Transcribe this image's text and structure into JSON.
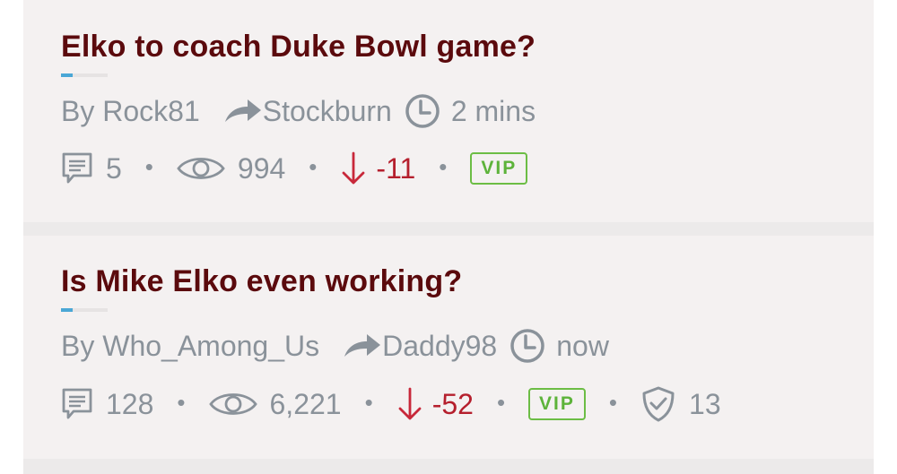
{
  "threads": [
    {
      "title": "Elko to coach Duke Bowl game?",
      "author": "By Rock81",
      "last_reply_by": "Stockburn",
      "time": "2 mins",
      "read_progress": 0.25,
      "replies": "5",
      "views": "994",
      "vote": "-11",
      "badge": "VIP"
    },
    {
      "title": "Is Mike Elko even working?",
      "author": "By Who_Among_Us",
      "last_reply_by": "Daddy98",
      "time": "now",
      "read_progress": 0.25,
      "replies": "128",
      "views": "6,221",
      "vote": "-52",
      "badge": "VIP",
      "protected_count": "13"
    }
  ],
  "icons": {
    "replies": "comment-icon",
    "views": "eye-icon",
    "vote": "arrow-down-icon",
    "last_reply": "share-arrow-icon",
    "time": "clock-icon",
    "protected": "shield-check-icon"
  },
  "colors": {
    "title": "#5b0a0d",
    "meta": "#8a929a",
    "negative": "#b51f2d",
    "vip": "#5db33a",
    "progress": "#4aa7d6"
  }
}
